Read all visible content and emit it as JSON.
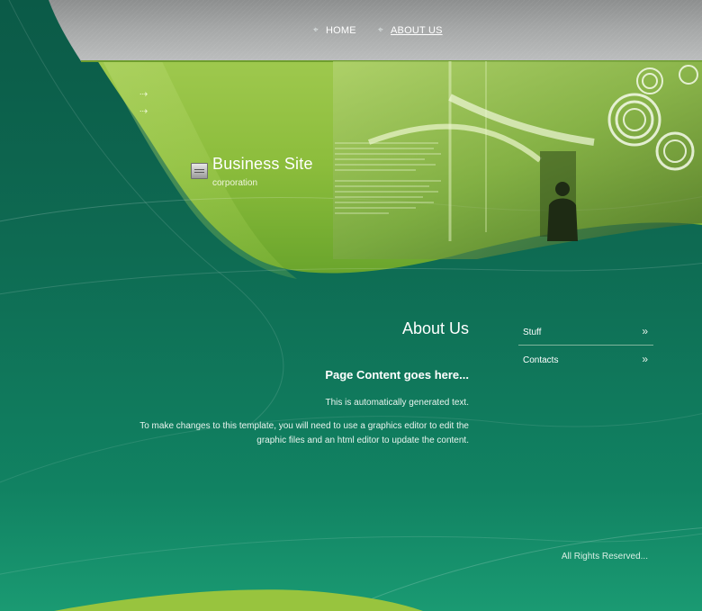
{
  "nav": {
    "items": [
      {
        "label": "HOME",
        "active": false
      },
      {
        "label": "ABOUT US",
        "active": true
      }
    ]
  },
  "header": {
    "title": "Business Site",
    "subtitle": "corporation"
  },
  "main": {
    "title": "About Us",
    "heading": "Page Content goes here...",
    "paragraphs": [
      "This is automatically generated text.",
      "To make changes to this template, you will need to use a graphics editor to edit the graphic files and an html editor to update the content."
    ]
  },
  "sidebar": {
    "items": [
      {
        "label": "Stuff",
        "arrow": "»"
      },
      {
        "label": "Contacts",
        "arrow": "»"
      }
    ]
  },
  "footer": {
    "text": "All Rights Reserved..."
  },
  "icons": {
    "nav_bullet": "crosshair-icon",
    "site_logo": "document-icon",
    "menu_arrow": "double-chevron-right-icon",
    "deco_arrows": "arrow-right-icon"
  },
  "colors": {
    "background_dark": "#0b5a47",
    "background_light": "#1a9a72",
    "lime_green": "#8fbe3a",
    "topbar_gray": "#9a9a9a"
  }
}
